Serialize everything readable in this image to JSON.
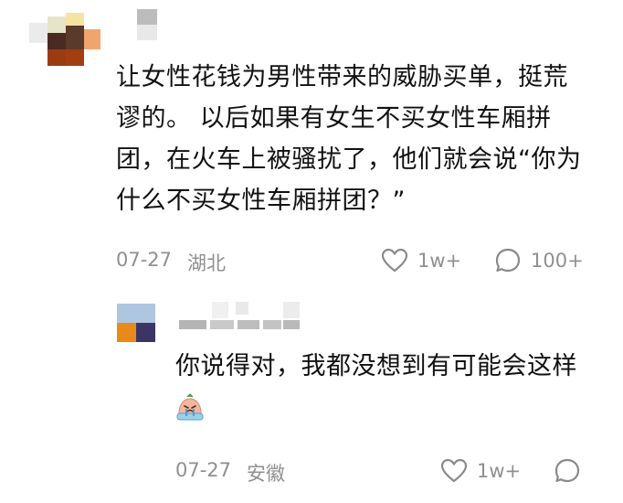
{
  "comments": [
    {
      "text": "让女性花钱为男性带来的威胁买单，挺荒谬的。 以后如果有女生不买女性车厢拼团，在火车上被骚扰了，他们就会说“你为什么不买女性车厢拼团？”",
      "date": "07-27",
      "location": "湖北",
      "likes": "1w+",
      "replies": "100+"
    },
    {
      "text": "你说得对，我都没想到有可能会这样",
      "date": "07-27",
      "location": "安徽",
      "likes": "1w+"
    }
  ],
  "colors": {
    "meta_text": "#8f8f8f",
    "body_text": "#111111"
  },
  "icons": {
    "like": "heart-outline-icon",
    "reply": "speech-bubble-icon",
    "emoji": "crying-face-emoji"
  }
}
